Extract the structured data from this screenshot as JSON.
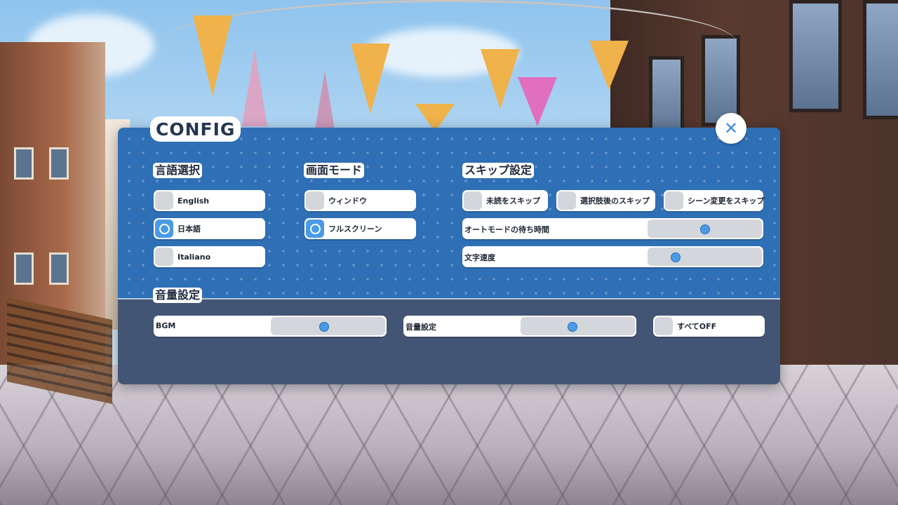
{
  "window": {
    "title": "CONFIG",
    "close_icon": "close-icon"
  },
  "language": {
    "heading": "言語選択",
    "options": [
      {
        "label": "English",
        "selected": false
      },
      {
        "label": "日本語",
        "selected": true
      },
      {
        "label": "Italiano",
        "selected": false
      }
    ]
  },
  "screen_mode": {
    "heading": "画面モード",
    "options": [
      {
        "label": "ウィンドウ",
        "selected": false
      },
      {
        "label": "フルスクリーン",
        "selected": true
      }
    ]
  },
  "skip": {
    "heading": "スキップ設定",
    "toggles": [
      {
        "label": "未読をスキップ",
        "checked": false
      },
      {
        "label": "選択肢後のスキップ",
        "checked": false
      },
      {
        "label": "シーン変更をスキップ",
        "checked": false
      }
    ],
    "auto_wait": {
      "label": "オートモードの待ち時間",
      "value": 0.5
    },
    "text_speed": {
      "label": "文字速度",
      "value": 0.22
    }
  },
  "volume": {
    "heading": "音量設定",
    "bgm": {
      "label": "BGM",
      "value": 0.46
    },
    "master": {
      "label": "音量設定",
      "value": 0.45
    },
    "all_off": {
      "label": "すべてOFF",
      "checked": false
    }
  },
  "colors": {
    "panel_top": "#2f6fb5",
    "panel_bottom": "#435575",
    "accent": "#4a9be6",
    "unchecked": "#d3d6db"
  }
}
